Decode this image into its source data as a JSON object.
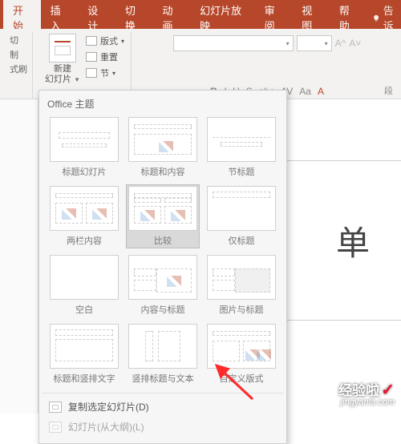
{
  "tabs": {
    "home": "开始",
    "insert": "插入",
    "design": "设计",
    "transition": "切换",
    "animation": "动画",
    "slideshow": "幻灯片放映",
    "review": "审阅",
    "view": "视图",
    "help": "帮助",
    "tell": "告诉"
  },
  "clipboard": {
    "cut": "切",
    "copy": "制",
    "painter": "式刷"
  },
  "slides": {
    "new_line1": "新建",
    "new_line2": "幻灯片",
    "layout": "版式",
    "reset": "重置",
    "section": "节"
  },
  "font": {
    "bold": "B",
    "italic": "I",
    "underline": "U",
    "strike": "S",
    "shadow": "abc",
    "spacing": "AV",
    "case": "Aa",
    "clear": "A"
  },
  "paragraph_label": "段",
  "panel": {
    "title": "Office 主题",
    "layouts": {
      "title_slide": "标题幻灯片",
      "title_content": "标题和内容",
      "section_header": "节标题",
      "two_content": "两栏内容",
      "comparison": "比较",
      "title_only": "仅标题",
      "blank": "空白",
      "content_caption": "内容与标题",
      "picture_caption": "图片与标题",
      "title_vertical": "标题和竖排文字",
      "vertical_title": "竖排标题与文本",
      "custom": "自定义版式"
    },
    "duplicate": "复制选定幻灯片(D)",
    "outline": "幻灯片(从大纲)(L)"
  },
  "canvas": {
    "placeholder": "单"
  },
  "watermark": {
    "cn": "经验啦",
    "en": "jingyanla.com"
  }
}
